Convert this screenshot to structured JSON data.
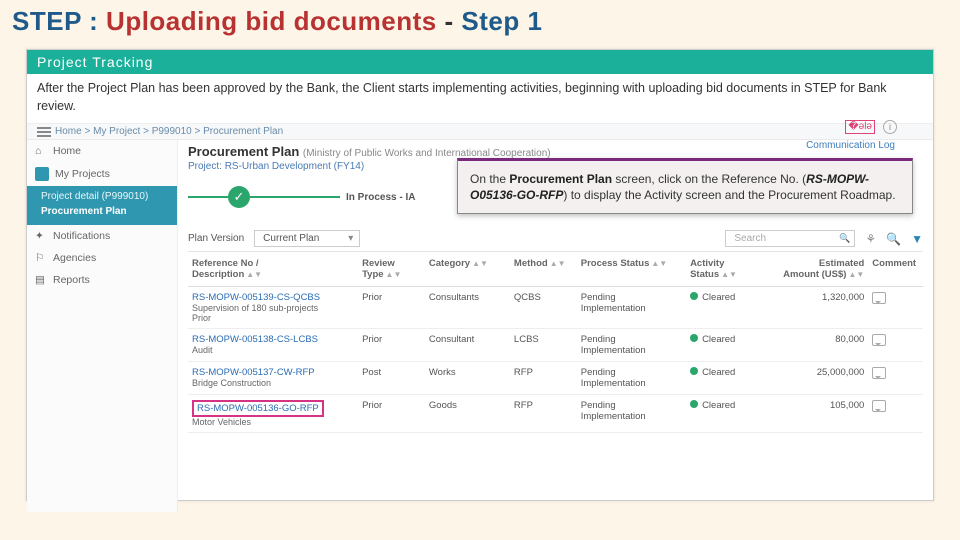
{
  "slide": {
    "t_step": "STEP : ",
    "t_mid": "Uploading bid documents",
    "t_dash": " - ",
    "t_step1": "Step 1"
  },
  "bar": "Project Tracking",
  "intro": "After the Project Plan has been approved by the Bank, the Client starts implementing activities, beginning with uploading bid documents in STEP for Bank review.",
  "breadcrumb": "Home > My Project > P999010 > Procurement Plan",
  "side": {
    "home": "Home",
    "myproj": "My Projects",
    "pd": "Project detail (P999010)",
    "pp": "Procurement Plan",
    "notif": "Notifications",
    "ag": "Agencies",
    "rep": "Reports"
  },
  "pp": {
    "title": "Procurement Plan",
    "sub": "(Ministry of Public Works and International Cooperation)",
    "project_lbl": "Project:",
    "project_val": "RS-Urban Development (FY14)",
    "process_lbl": "In Process - IA",
    "commlog": "Communication Log"
  },
  "callout": {
    "p1a": "On the ",
    "p1b": "Procurement Plan",
    "p1c": " screen, click on the Reference No. (",
    "p1d": "RS-MOPW-O05136-GO-RFP",
    "p1e": ") to display the Activity screen and the Procurement Roadmap."
  },
  "pv": {
    "lbl": "Plan Version",
    "sel": "Current Plan",
    "search": "Search"
  },
  "cols": {
    "c1a": "Reference No /",
    "c1b": "Description",
    "c2": "Review",
    "c2b": "Type",
    "c3": "Category",
    "c4": "Method",
    "c5": "Process Status",
    "c6a": "Activity",
    "c6b": "Status",
    "c7a": "Estimated",
    "c7b": "Amount (US$)",
    "c8": "Comment"
  },
  "rows": [
    {
      "ref": "RS-MOPW-005139-CS-QCBS",
      "desc": "Supervision of 180 sub-projects",
      "desc2": "Prior",
      "rtype": "Prior",
      "cat": "Consultants",
      "method": "QCBS",
      "pstat": "Pending Implementation",
      "astat": "Cleared",
      "amt": "1,320,000"
    },
    {
      "ref": "RS-MOPW-005138-CS-LCBS",
      "desc": "Audit",
      "desc2": "",
      "rtype": "Prior",
      "cat": "Consultant",
      "method": "LCBS",
      "pstat": "Pending Implementation",
      "astat": "Cleared",
      "amt": "80,000"
    },
    {
      "ref": "RS-MOPW-005137-CW-RFP",
      "desc": "Bridge Construction",
      "desc2": "",
      "rtype": "Post",
      "cat": "Works",
      "method": "RFP",
      "pstat": "Pending Implementation",
      "astat": "Cleared",
      "amt": "25,000,000"
    },
    {
      "ref": "RS-MOPW-005136-GO-RFP",
      "desc": "Motor Vehicles",
      "desc2": "",
      "rtype": "Prior",
      "cat": "Goods",
      "method": "RFP",
      "pstat": "Pending Implementation",
      "astat": "Cleared",
      "amt": "105,000",
      "hl": true
    }
  ]
}
